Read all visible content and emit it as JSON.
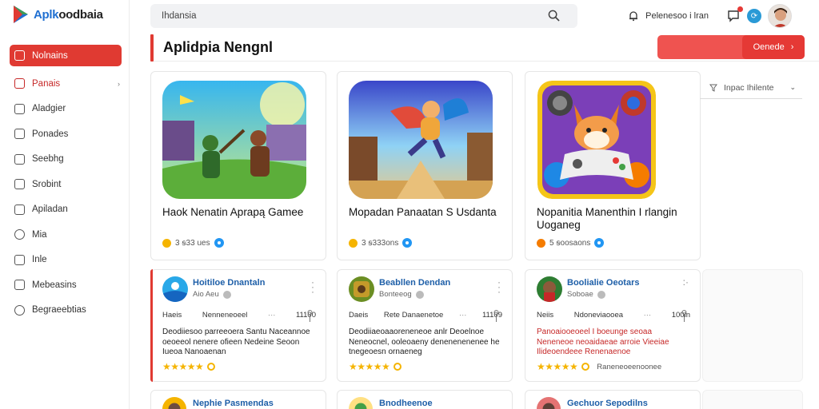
{
  "app": {
    "logo_text_blue": "Aplk",
    "logo_text_rest": "oodbaia",
    "brand_color": "#e03a32"
  },
  "sidebar": {
    "items": [
      {
        "label": "Nolnains",
        "icon": "home-icon",
        "active": true
      },
      {
        "label": "Panais",
        "icon": "grid-icon",
        "chevron": true,
        "red": true
      },
      {
        "label": "Aladgier",
        "icon": "folder-icon"
      },
      {
        "label": "Ponades",
        "icon": "layers-icon"
      },
      {
        "label": "Seebhg",
        "icon": "edit-icon"
      },
      {
        "label": "Srobint",
        "icon": "square-icon"
      },
      {
        "label": "Apiladan",
        "icon": "list-icon"
      },
      {
        "label": "Mia",
        "icon": "user-icon"
      },
      {
        "label": "Inle",
        "icon": "tool-icon"
      },
      {
        "label": "Mebeasins",
        "icon": "bookmark-icon"
      },
      {
        "label": "Begraeebtias",
        "icon": "settings-icon"
      }
    ]
  },
  "header": {
    "search_text": "Ihdansia",
    "user_name": "Pelenesoo i lran",
    "notification_count_dot": true
  },
  "main": {
    "page_title": "Aplidpia Nengnl",
    "banner_button_label": "Oenede",
    "filter_label": "Inpac Ihilente"
  },
  "featured": [
    {
      "name": "Haok Nenatin Aprapą Gamee",
      "meta": "3 ꞩ33 ues",
      "art": "battle-game-icon"
    },
    {
      "name": "Mopadan Panaatan S Usdanta",
      "meta": "3 ꞩ333ons",
      "art": "flying-hero-game-icon"
    },
    {
      "name": "Nopanitia Manenthin I rlangin Uoganeg",
      "meta": "5 ꞩoosaons",
      "art": "fox-controller-game-icon"
    }
  ],
  "list_cards": [
    {
      "title": "Hoitiloe Dnantaln",
      "sub": "Aio Aeu",
      "row_left": "Haeis",
      "row_mid": "Nenneneoeel",
      "row_right": "11100",
      "desc": "Deodiiesoo parreeoera Santu Naceannoe oeoeeol nenere ofieen Nedeine Seoon Iueoa Nanoaenan",
      "alt": false,
      "rating": "★★★★★",
      "extra": "",
      "selected": true
    },
    {
      "title": "Beabllen Dendan",
      "sub": "Bonteeog",
      "row_left": "Daeis",
      "row_mid": "Rete Danaenetoe",
      "row_right": "11109",
      "desc": "Deodiiaeoaaoreneneoe anlr Deoelnoe Neneocnel, ooleoaeny denenenenenee he tnegeoesn ornaeneg",
      "alt": false,
      "rating": "★★★★★",
      "extra": "",
      "selected": false
    },
    {
      "title": "Boolialie Oeotars",
      "sub": "Soboae",
      "row_left": "Neiis",
      "row_mid": "Ndoneviaooea",
      "row_right": "100ln",
      "desc": "Panoaiooeoeel I boeunge seoaa Neneneoe neoaidaeae arroie Vieeiae Ilideoendeee Renenaenoe",
      "alt": true,
      "rating": "★★★★★",
      "extra": "Raneneoeenoonee",
      "selected": false
    }
  ],
  "bottom_cards": [
    {
      "title": "Nephie Pasmendas"
    },
    {
      "title": "Bnodheenoe"
    },
    {
      "title": "Gechuor Sepodilns"
    }
  ]
}
